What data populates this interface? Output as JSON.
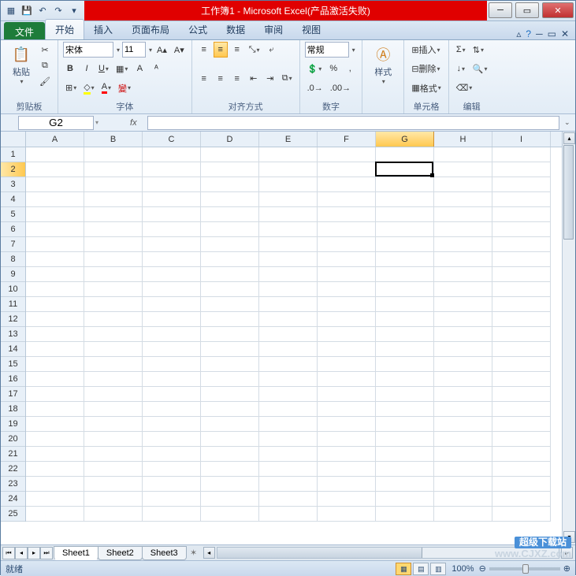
{
  "titlebar": {
    "title": "工作簿1 - Microsoft Excel(产品激活失败)"
  },
  "tabs": {
    "file": "文件",
    "items": [
      "开始",
      "插入",
      "页面布局",
      "公式",
      "数据",
      "审阅",
      "视图"
    ],
    "active": 0
  },
  "ribbon": {
    "clipboard": {
      "paste": "粘贴",
      "label": "剪贴板"
    },
    "font": {
      "name": "宋体",
      "size": "11",
      "label": "字体"
    },
    "align": {
      "label": "对齐方式"
    },
    "number": {
      "format": "常规",
      "label": "数字"
    },
    "styles": {
      "btn": "样式",
      "label": ""
    },
    "cells": {
      "insert": "插入",
      "delete": "删除",
      "format": "格式",
      "label": "单元格"
    },
    "editing": {
      "label": "编辑"
    }
  },
  "formula": {
    "cellref": "G2",
    "fx": "fx",
    "value": ""
  },
  "grid": {
    "cols": [
      "A",
      "B",
      "C",
      "D",
      "E",
      "F",
      "G",
      "H",
      "I"
    ],
    "rows": [
      1,
      2,
      3,
      4,
      5,
      6,
      7,
      8,
      9,
      10,
      11,
      12,
      13,
      14,
      15,
      16,
      17,
      18,
      19,
      20,
      21,
      22,
      23,
      24,
      25
    ],
    "selCol": 6,
    "selRow": 1
  },
  "sheets": {
    "tabs": [
      "Sheet1",
      "Sheet2",
      "Sheet3"
    ],
    "active": 0
  },
  "status": {
    "ready": "就绪",
    "zoom": "100%"
  },
  "watermark": {
    "cn": "超级下载站",
    "url": "www.CJXZ.com"
  }
}
